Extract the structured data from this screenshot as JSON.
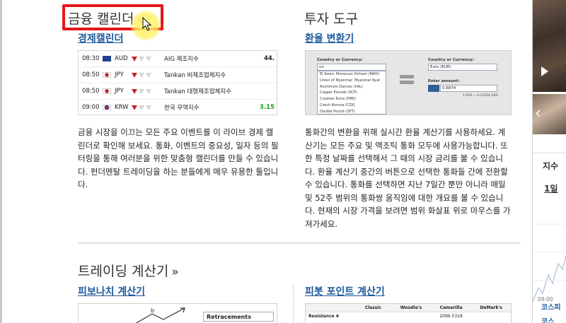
{
  "left_section": {
    "title": "금융 캘린더",
    "title_arrow": "»",
    "link": "경제캘린더",
    "description": "금융 시장을 이끄는 모든 주요 이벤트를 이 라이브 경제 캘린더로 확인해 보세요. 통화, 이벤트의 중요성, 일자 등의 필터링을 통해 여러분을 위한 맞춤형 캘린더를 만들 수 있습니다. 펀더멘탈 트레이딩을 하는 분들에게 매우 유용한 툴입니다.",
    "calendar_rows": [
      {
        "time": "08:30",
        "currency": "AUD",
        "flag": "australia-flag-icon",
        "importance": 1,
        "event": "AIG 제조지수",
        "value": "44.",
        "value_color": "#222222"
      },
      {
        "time": "08:50",
        "currency": "JPY",
        "flag": "japan-flag-icon",
        "importance": 1,
        "event": "Tankan 비제조업체지수",
        "value": "",
        "value_color": "#222222"
      },
      {
        "time": "08:50",
        "currency": "JPY",
        "flag": "japan-flag-icon",
        "importance": 1,
        "event": "Tankan 대형제조업체지수",
        "value": "",
        "value_color": "#222222"
      },
      {
        "time": "09:00",
        "currency": "KRW",
        "flag": "korea-flag-icon",
        "importance": 1,
        "event": "한국 무역지수",
        "value": "3.15",
        "value_color": "#1a9c1a"
      }
    ]
  },
  "right_section": {
    "title": "투자 도구",
    "link": "환율 변환기",
    "description": "통화간의 변환을 위해 실시간 환율 계산기를 사용하세요. 계산기는 모든 주요 및 엑조틱 통화 모두에 사용가능합니다. 또한 특정 날짜를 선택해서 그 때의 시장 금리를 볼 수 있습니다. 환율 계산기 중간의 버튼으로 선택한 통화들 간에 전환할 수 있습니다. 통화를 선택하면 지난 7일간 뿐만 아니라 매일 및 52주 범위의 통화쌍 움직임에 대한 개요를 볼 수 있습니다. 현재의 시장 가격을 보려면 범위 화살표 위로 마우스를 가져가세요.",
    "converter": {
      "left_label": "Country or Currency:",
      "left_value": "un",
      "right_label": "Country or Currency:",
      "right_value": "Euro (EUR)",
      "amount_label": "Enter amount:",
      "amount_value": "0.6874",
      "rate_note": "1 EUR = 0.12454 USD",
      "list": [
        "El Asian: Moroccan Dirham (MAD)",
        "Union of Myanmar: Myanmar Kyat",
        "Aluminum Ounces (XAL)",
        "Copper Pounds (XCP)",
        "Croatian Kuna (HRK)",
        "Czech Koruna (CZK)",
        "Double Pound (ZPT)"
      ]
    }
  },
  "bottom_section": {
    "title": "트레이딩 계산기",
    "title_arrow": "»",
    "left_link": "피보나치 계산기",
    "right_link": "피봇 포인트 계산기",
    "fib_box_label": "Retracements",
    "pivot_headers": [
      "",
      "Classic",
      "Woodie's",
      "Camarilla",
      "DeMark's"
    ],
    "pivot_row": [
      "Resistance 4",
      "",
      "",
      "2096.5318",
      ""
    ]
  },
  "sidebar": {
    "index_label": "지수",
    "day_label": "1일",
    "time_label": "09:00",
    "kospi_label": "코스피",
    "kospi2_label": "코스"
  },
  "colors": {
    "link": "#1d5a9c",
    "highlight_border": "#e3171b",
    "importance_on": "#c0262d"
  }
}
